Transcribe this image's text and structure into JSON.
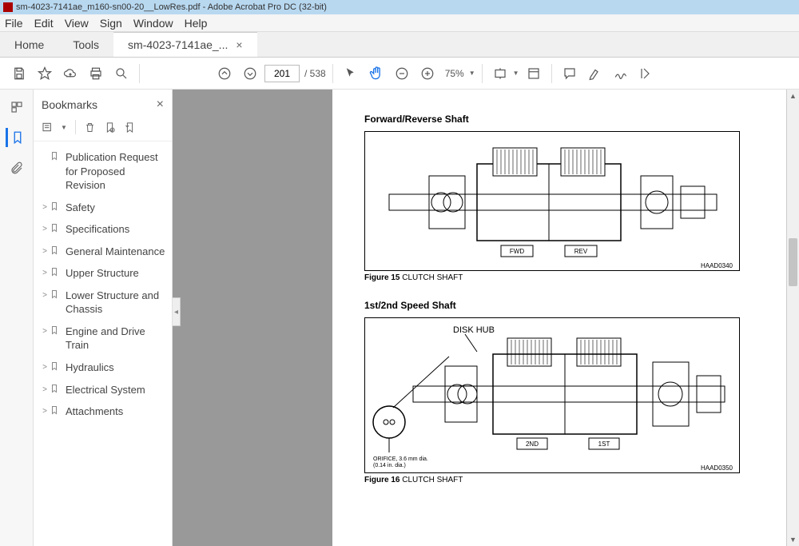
{
  "titlebar": {
    "text": "sm-4023-7141ae_m160-sn00-20__LowRes.pdf - Adobe Acrobat Pro DC (32-bit)"
  },
  "menubar": {
    "items": [
      "File",
      "Edit",
      "View",
      "Sign",
      "Window",
      "Help"
    ]
  },
  "tabs": {
    "home": "Home",
    "tools": "Tools",
    "doc": "sm-4023-7141ae_..."
  },
  "toolbar": {
    "page_current": "201",
    "page_total": "/ 538",
    "zoom": "75%"
  },
  "bookmarks": {
    "title": "Bookmarks",
    "items": [
      {
        "label": "Publication Request for Proposed Revision",
        "expandable": false
      },
      {
        "label": "Safety",
        "expandable": true
      },
      {
        "label": "Specifications",
        "expandable": true
      },
      {
        "label": "General Maintenance",
        "expandable": true
      },
      {
        "label": "Upper Structure",
        "expandable": true
      },
      {
        "label": "Lower Structure and Chassis",
        "expandable": true
      },
      {
        "label": "Engine and Drive Train",
        "expandable": true
      },
      {
        "label": "Hydraulics",
        "expandable": true
      },
      {
        "label": "Electrical System",
        "expandable": true
      },
      {
        "label": "Attachments",
        "expandable": true
      }
    ]
  },
  "page": {
    "fig1_title": "Forward/Reverse Shaft",
    "fig1_caption_bold": "Figure 15",
    "fig1_caption_text": " CLUTCH SHAFT",
    "fig1_code": "HAAD0340",
    "fig1_label_fwd": "FWD",
    "fig1_label_rev": "REV",
    "fig2_title": "1st/2nd Speed Shaft",
    "fig2_caption_bold": "Figure 16",
    "fig2_caption_text": " CLUTCH SHAFT",
    "fig2_code": "HAAD0350",
    "fig2_label_1st": "1ST",
    "fig2_label_2nd": "2ND",
    "fig2_label_diskhub": "DISK HUB",
    "fig2_label_orifice": "ORIFICE, 3.6 mm dia.\n(0.14 in. dia.)"
  }
}
